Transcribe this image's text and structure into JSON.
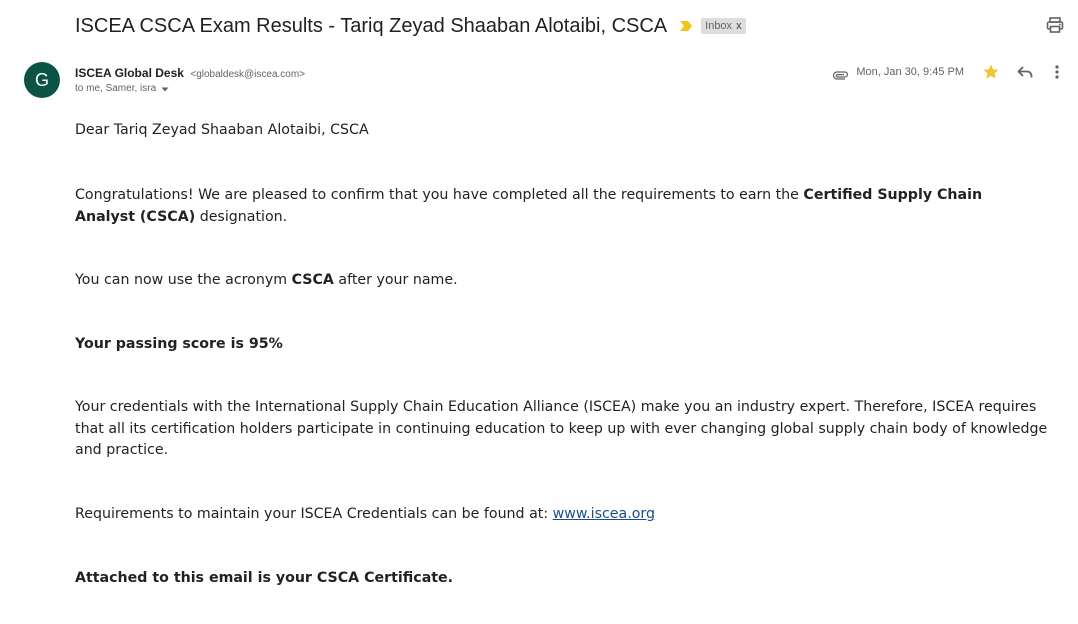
{
  "header": {
    "subject": "ISCEA CSCA Exam Results - Tariq Zeyad Shaaban Alotaibi, CSCA",
    "label": "Inbox",
    "label_remove": "x"
  },
  "sender": {
    "avatar_letter": "G",
    "name": "ISCEA Global Desk",
    "email": "<globaldesk@iscea.com>",
    "recipients": "to me, Samer, isra",
    "date": "Mon, Jan 30, 9:45 PM"
  },
  "icons": {
    "important": "important-marker-icon",
    "print": "print-icon",
    "attachment": "paperclip-icon",
    "star": "star-icon",
    "reply": "reply-icon",
    "more": "more-vert-icon",
    "caret": "caret-down-icon"
  },
  "colors": {
    "avatar": "#0b5345",
    "star": "#f4c430",
    "important": "#f5c518",
    "link": "#1a4e8a"
  },
  "body": {
    "greeting": "Dear Tariq Zeyad Shaaban Alotaibi, CSCA",
    "congrats_before": "Congratulations! We are pleased to confirm that you have completed all the requirements to earn the ",
    "congrats_bold": "Certified Supply Chain Analyst (CSCA)",
    "congrats_after": " designation.",
    "acronym_before": "You can now use the acronym ",
    "acronym_bold": "CSCA",
    "acronym_after": " after your name.",
    "score": "Your passing score is 95%",
    "credentials": "Your credentials with the International Supply Chain Education Alliance (ISCEA) make you an industry expert. Therefore, ISCEA requires that all its certification holders participate in continuing education to keep up with ever changing global supply chain body of knowledge and practice.",
    "requirements_text": "Requirements to maintain your ISCEA Credentials can be found at: ",
    "requirements_link": "www.iscea.org",
    "attached": "Attached to this email is your CSCA Certificate."
  }
}
